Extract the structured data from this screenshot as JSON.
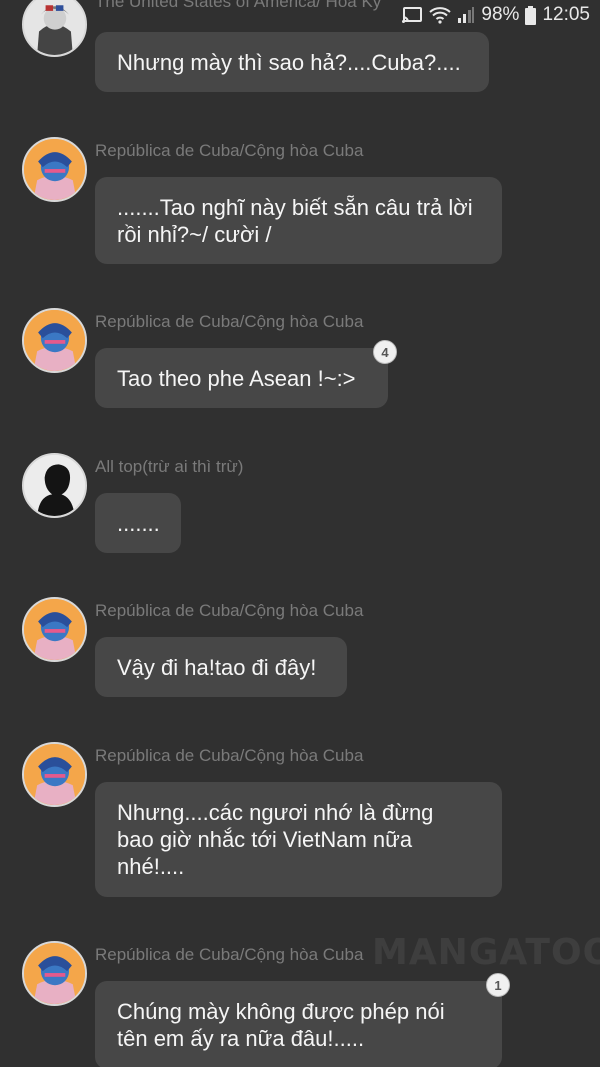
{
  "status_bar": {
    "battery": "98%",
    "time": "12:05"
  },
  "watermark": "MANGATOON",
  "messages": [
    {
      "sender": "The United States of America/ Hoa Kỳ",
      "text": "Nhưng mày thì sao hả?....Cuba?....",
      "avatar": "usa-avatar"
    },
    {
      "sender": "República de Cuba/Cộng hòa Cuba",
      "text": ".......Tao nghĩ này biết sẵn câu trả lời rồi nhỉ?~/ cười /",
      "avatar": "cuba-avatar"
    },
    {
      "sender": "República de Cuba/Cộng hòa Cuba",
      "text": "Tao theo phe Asean !~:>",
      "avatar": "cuba-avatar",
      "badge": "4"
    },
    {
      "sender": "All top(trừ ai thì trừ)",
      "text": ".......",
      "avatar": "silhouette-avatar"
    },
    {
      "sender": "República de Cuba/Cộng hòa Cuba",
      "text": "Vậy đi ha!tao đi đây!",
      "avatar": "cuba-avatar"
    },
    {
      "sender": "República de Cuba/Cộng hòa Cuba",
      "text": "Nhưng....các ngươi nhớ là đừng bao giờ nhắc tới VietNam nữa nhé!....",
      "avatar": "cuba-avatar"
    },
    {
      "sender": "República de Cuba/Cộng hòa Cuba",
      "text": "Chúng mày không được phép nói tên em ấy ra nữa đâu!.....",
      "avatar": "cuba-avatar",
      "badge": "1"
    }
  ]
}
